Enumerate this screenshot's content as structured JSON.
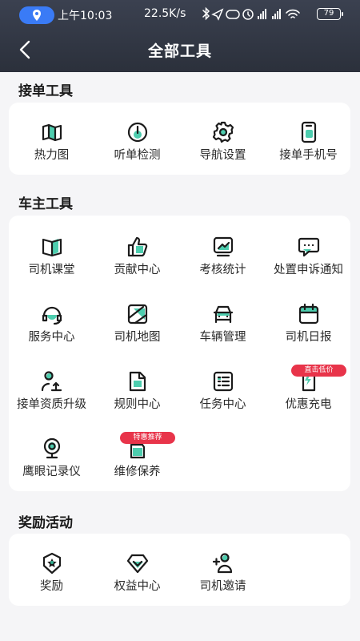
{
  "status_bar": {
    "time": "上午10:03",
    "net_speed": "22.5K/s",
    "battery": "79"
  },
  "header": {
    "title": "全部工具"
  },
  "sections": [
    {
      "title": "接单工具",
      "items": [
        {
          "label": "热力图",
          "icon": "map-fold-icon"
        },
        {
          "label": "听单检测",
          "icon": "clock-icon"
        },
        {
          "label": "导航设置",
          "icon": "gear-icon"
        },
        {
          "label": "接单手机号",
          "icon": "phone-icon"
        }
      ]
    },
    {
      "title": "车主工具",
      "items": [
        {
          "label": "司机课堂",
          "icon": "book-icon"
        },
        {
          "label": "贡献中心",
          "icon": "thumbs-up-icon"
        },
        {
          "label": "考核统计",
          "icon": "chart-icon"
        },
        {
          "label": "处置申诉通知",
          "icon": "chat-icon"
        },
        {
          "label": "服务中心",
          "icon": "headset-icon"
        },
        {
          "label": "司机地图",
          "icon": "map-icon"
        },
        {
          "label": "车辆管理",
          "icon": "car-icon"
        },
        {
          "label": "司机日报",
          "icon": "calendar-icon"
        },
        {
          "label": "接单资质升级",
          "icon": "user-upgrade-icon"
        },
        {
          "label": "规则中心",
          "icon": "document-icon"
        },
        {
          "label": "任务中心",
          "icon": "checklist-icon"
        },
        {
          "label": "优惠充电",
          "icon": "charging-icon",
          "tag": "直击低价"
        },
        {
          "label": "鹰眼记录仪",
          "icon": "camera-icon"
        },
        {
          "label": "维修保养",
          "icon": "oil-can-icon",
          "tag": "特惠推荐"
        }
      ]
    },
    {
      "title": "奖励活动",
      "items": [
        {
          "label": "奖励",
          "icon": "star-badge-icon"
        },
        {
          "label": "权益中心",
          "icon": "diamond-icon"
        },
        {
          "label": "司机邀请",
          "icon": "user-add-icon"
        }
      ]
    }
  ],
  "colors": {
    "header": "#2f3440",
    "accent": "#2ec4a0",
    "tag": "#e8344a",
    "location_pill": "#3a7bf6"
  }
}
